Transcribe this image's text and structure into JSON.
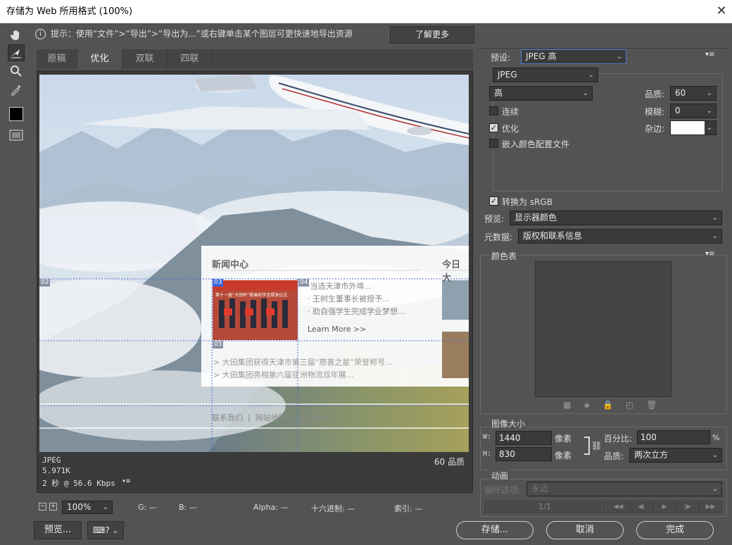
{
  "window": {
    "title": "存储为 Web 所用格式 (100%)"
  },
  "hint": {
    "text": "提示：使用“文件”>“导出”>“导出为...”或右键单击某个图层可更快速地导出资源",
    "learn_more": "了解更多"
  },
  "tabs": [
    "原稿",
    "优化",
    "双联",
    "四联"
  ],
  "preview": {
    "news_title": "新闻中心",
    "today_title": "今日大",
    "news_items_right": [
      "·当选天津市外埠...",
      "· 王树生董事长被授予...",
      "· 助自强学生完成学业梦想..."
    ],
    "learn_more": "Learn More >>",
    "news_items_bottom": [
      "> 大田集团获得天津市第三届“慈善之星”荣誉称号...",
      "> 大田集团亮相第六届亚洲物流双年展..."
    ],
    "footer_links": [
      "联系我们",
      "网站地图",
      "客服电话"
    ],
    "slice_labels": [
      "02",
      "03",
      "04",
      "05"
    ],
    "photo_caption": "第十一届“大田杯”慈善助学金颁发仪式"
  },
  "info": {
    "format": "JPEG",
    "size": "5.971K",
    "speed": "2 秒 @ 56.6 Kbps",
    "quality_label": "60 品质"
  },
  "status": {
    "zoom": "100%",
    "g": "G: —",
    "b": "B: —",
    "alpha": "Alpha: —",
    "hex": "十六进制: —",
    "index": "索引: —"
  },
  "right": {
    "preset_label": "预设:",
    "preset_value": "JPEG 高",
    "format": "JPEG",
    "quality_preset": "高",
    "quality_label": "品质:",
    "quality_value": "60",
    "blur_label": "模糊:",
    "blur_value": "0",
    "matte_label": "杂边:",
    "progressive": "连续",
    "optimized": "优化",
    "embed_profile": "嵌入颜色配置文件",
    "convert_srgb": "转换为 sRGB",
    "preview_label": "预览:",
    "preview_value": "显示器颜色",
    "metadata_label": "元数据:",
    "metadata_value": "版权和联系信息",
    "color_table": "颜色表",
    "image_size": "图像大小",
    "w_label": "W:",
    "w_value": "1440",
    "h_label": "H:",
    "h_value": "830",
    "px": "像素",
    "percent_label": "百分比:",
    "percent_value": "100",
    "percent_unit": "%",
    "resample_label": "品质:",
    "resample_value": "两次立方",
    "animation": "动画",
    "loop_label": "循环选项:",
    "loop_value": "永远",
    "frame": "1/1"
  },
  "buttons": {
    "preview": "预览...",
    "save": "存储...",
    "cancel": "取消",
    "done": "完成"
  },
  "colors": {
    "panel": "#535353",
    "dark": "#3a3a3a"
  }
}
